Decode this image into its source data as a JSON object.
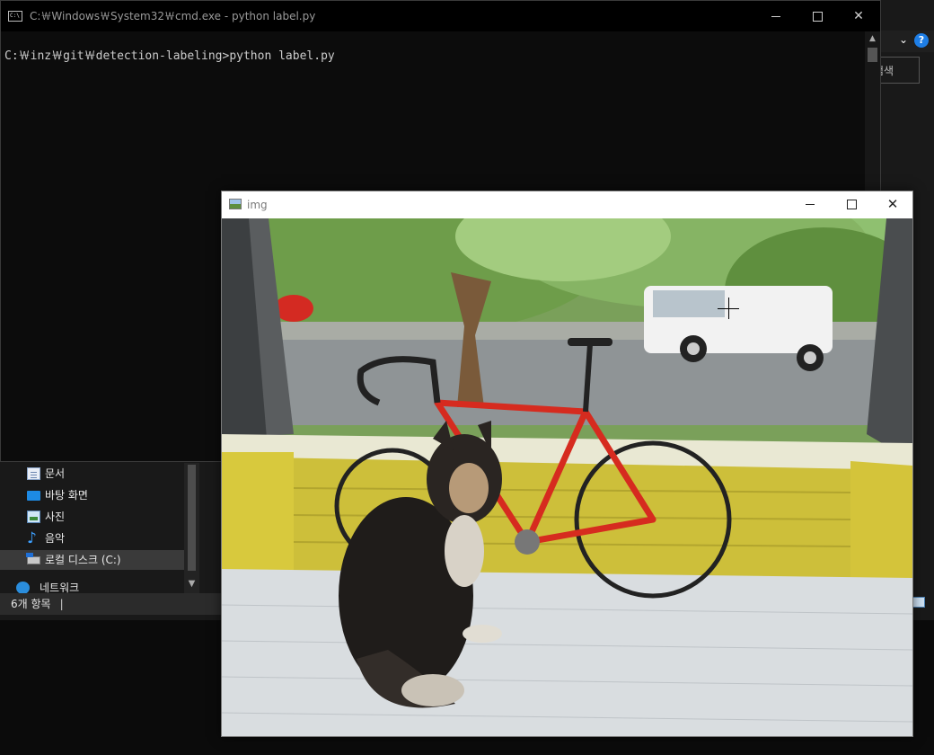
{
  "explorer": {
    "search_placeholder": "검색",
    "chevron": "⌄",
    "help": "?",
    "nav_items": [
      {
        "label": "문서",
        "icon": "document-icon"
      },
      {
        "label": "바탕 화면",
        "icon": "desktop-icon"
      },
      {
        "label": "사진",
        "icon": "pictures-icon"
      },
      {
        "label": "음악",
        "icon": "music-icon"
      },
      {
        "label": "로컬 디스크 (C:)",
        "icon": "drive-icon",
        "selected": true
      },
      {
        "label": "네트워크",
        "icon": "network-icon"
      }
    ],
    "status": {
      "item_count": "6개 항목",
      "separator": "|"
    }
  },
  "cmd": {
    "title": "C:￦Windows￦System32￦cmd.exe - python  label.py",
    "icon_text": "C:\\",
    "prompt_line": "C:￦inz￦git￦detection-labeling>python label.py",
    "minimize": "",
    "maximize": "",
    "close": "✕"
  },
  "image_window": {
    "title": "img",
    "close": "✕"
  },
  "colors": {
    "cmd_bg": "#0c0c0c",
    "cmd_text": "#cccccc",
    "explorer_bg": "#191919",
    "accent": "#1e7ee6"
  }
}
